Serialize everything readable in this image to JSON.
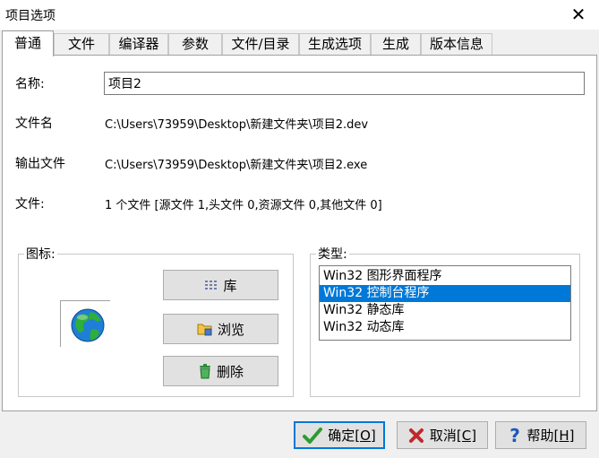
{
  "window": {
    "title": "项目选项",
    "close_label": "✕"
  },
  "tabs": [
    {
      "label": "普通",
      "active": true
    },
    {
      "label": "文件"
    },
    {
      "label": "编译器"
    },
    {
      "label": "参数"
    },
    {
      "label": "文件/目录"
    },
    {
      "label": "生成选项"
    },
    {
      "label": "生成"
    },
    {
      "label": "版本信息"
    }
  ],
  "general": {
    "name_label": "名称:",
    "name_value": "项目2",
    "filename_label": "文件名",
    "filename_value": "C:\\Users\\73959\\Desktop\\新建文件夹\\项目2.dev",
    "output_label": "输出文件",
    "output_value": "C:\\Users\\73959\\Desktop\\新建文件夹\\项目2.exe",
    "files_label": "文件:",
    "files_value": "1 个文件 [源文件 1,头文件 0,资源文件 0,其他文件 0]"
  },
  "icon_group": {
    "title": "图标:",
    "library_button": "库",
    "browse_button": "浏览",
    "delete_button": "删除"
  },
  "type_group": {
    "title": "类型:",
    "options": [
      "Win32 图形界面程序",
      "Win32 控制台程序",
      "Win32 静态库",
      "Win32 动态库"
    ],
    "selected_index": 1
  },
  "buttons": {
    "ok": "确定",
    "ok_key": "[O]",
    "cancel": "取消",
    "cancel_key": "[C]",
    "help": "帮助",
    "help_key": "[H]"
  },
  "colors": {
    "selection": "#0078d7",
    "ok_check": "#2e9b2e",
    "cancel_x": "#c0282c",
    "help_q": "#1b58b8"
  }
}
